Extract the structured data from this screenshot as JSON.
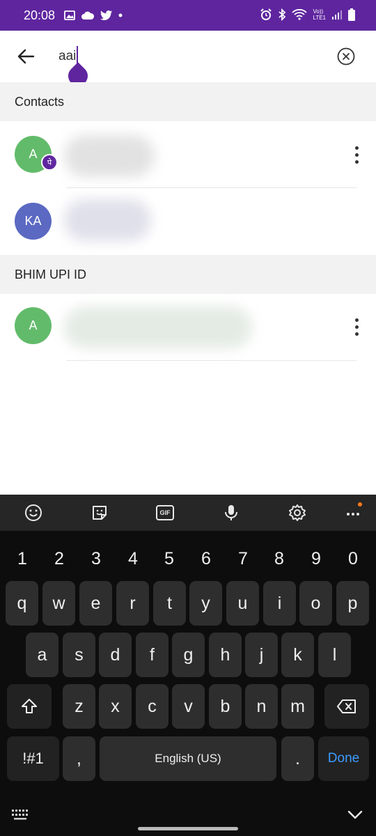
{
  "status_bar": {
    "time": "20:08",
    "network_label_top": "Vo))",
    "network_label_bottom": "LTE1",
    "bg_color": "#5f259f"
  },
  "search": {
    "query": "aai",
    "back_icon": "arrow-left-icon",
    "clear_icon": "close-circle-icon"
  },
  "sections": [
    {
      "title": "Contacts",
      "contacts": [
        {
          "avatar_text": "A",
          "avatar_color": "#62bb6a",
          "badge_text": "पे",
          "has_more": true
        },
        {
          "avatar_text": "KA",
          "avatar_color": "#5b69c2",
          "has_more": false
        }
      ]
    },
    {
      "title": "BHIM UPI ID",
      "contacts": [
        {
          "avatar_text": "A",
          "avatar_color": "#62bb6a",
          "has_more": true
        }
      ]
    }
  ],
  "keyboard": {
    "toolbar_icons": [
      "emoji-icon",
      "sticker-icon",
      "gif-icon",
      "microphone-icon",
      "settings-icon",
      "more-icon"
    ],
    "gif_label": "GIF",
    "rows": [
      [
        "1",
        "2",
        "3",
        "4",
        "5",
        "6",
        "7",
        "8",
        "9",
        "0"
      ],
      [
        "q",
        "w",
        "e",
        "r",
        "t",
        "y",
        "u",
        "i",
        "o",
        "p"
      ],
      [
        "a",
        "s",
        "d",
        "f",
        "g",
        "h",
        "j",
        "k",
        "l"
      ],
      [
        "z",
        "x",
        "c",
        "v",
        "b",
        "n",
        "m"
      ]
    ],
    "symbols_key": "!#1",
    "comma_key": ",",
    "space_label": "English (US)",
    "period_key": ".",
    "done_label": "Done",
    "accent_color": "#3d9bff"
  }
}
